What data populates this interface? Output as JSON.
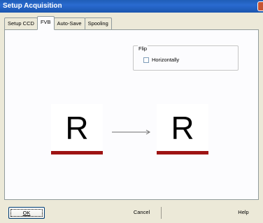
{
  "window": {
    "title": "Setup Acquisition"
  },
  "tabs": [
    {
      "label": "Setup CCD"
    },
    {
      "label": "FVB"
    },
    {
      "label": "Auto-Save"
    },
    {
      "label": "Spooling"
    }
  ],
  "flip": {
    "group_label": "Flip",
    "horizontally_label": "Horizontally",
    "horizontally_checked": false
  },
  "preview": {
    "before_letter": "R",
    "after_letter": "R",
    "underline_color": "#9E1414"
  },
  "buttons": {
    "ok": "OK",
    "cancel": "Cancel",
    "help": "Help"
  }
}
